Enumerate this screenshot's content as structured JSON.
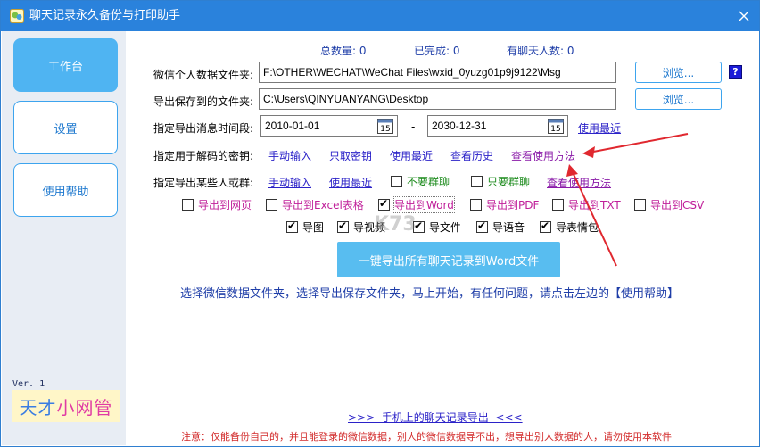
{
  "window": {
    "title": "聊天记录永久备份与打印助手"
  },
  "sidebar": {
    "items": [
      {
        "label": "工作台"
      },
      {
        "label": "设置"
      },
      {
        "label": "使用帮助"
      }
    ],
    "version": "Ver. 1",
    "logo_part1": "天才",
    "logo_part2": "小网管"
  },
  "stats": {
    "total": "总数量: 0",
    "done": "已完成: 0",
    "friends": "有聊天人数: 0"
  },
  "form": {
    "wechat_folder_label": "微信个人数据文件夹:",
    "wechat_folder_value": "F:\\OTHER\\WECHAT\\WeChat Files\\wxid_0yuzg01p9j9122\\Msg",
    "save_folder_label": "导出保存到的文件夹:",
    "save_folder_value": "C:\\Users\\QINYUANYANG\\Desktop",
    "browse_label": "浏览...",
    "help_q": "?",
    "time_label": "指定导出消息时间段:",
    "date_from": "2010-01-01",
    "date_sep": "-",
    "date_to": "2030-12-31",
    "use_recent": "使用最近",
    "calendar_day": "15"
  },
  "key_row": {
    "label": "指定用于解码的密钥:",
    "manual": "手动输入",
    "fetch": "只取密钥",
    "recent": "使用最近",
    "history": "查看历史",
    "howto": "查看使用方法"
  },
  "contact_row": {
    "label": "指定导出某些人或群:",
    "manual": "手动输入",
    "recent": "使用最近",
    "no_group": "不要群聊",
    "only_group": "只要群聊",
    "howto": "查看使用方法"
  },
  "export_formats": [
    {
      "label": "导出到网页",
      "checked": false
    },
    {
      "label": "导出到Excel表格",
      "checked": false
    },
    {
      "label": "导出到Word",
      "checked": true
    },
    {
      "label": "导出到PDF",
      "checked": false
    },
    {
      "label": "导出到TXT",
      "checked": false
    },
    {
      "label": "导出到CSV",
      "checked": false
    }
  ],
  "media_options": [
    {
      "label": "导图",
      "checked": true
    },
    {
      "label": "导视频",
      "checked": true
    },
    {
      "label": "导文件",
      "checked": true
    },
    {
      "label": "导语音",
      "checked": true
    },
    {
      "label": "导表情包",
      "checked": true
    }
  ],
  "export_button": "一键导出所有聊天记录到Word文件",
  "hint": "选择微信数据文件夹，选择导出保存文件夹，马上开始，有任何问题，请点击左边的【使用帮助】",
  "mobile_link": ">>>  手机上的聊天记录导出  <<<",
  "notice": "注意：仅能备份自己的，并且能登录的微信数据，别人的微信数据导不出，想导出别人数据的人，请勿使用本软件",
  "watermark": "K73",
  "colors": {
    "titlebar": "#2a82dc",
    "accent": "#4fb4f2",
    "link": "#2b22c8",
    "notice": "#d22a2a",
    "arrow": "#e0282f"
  }
}
